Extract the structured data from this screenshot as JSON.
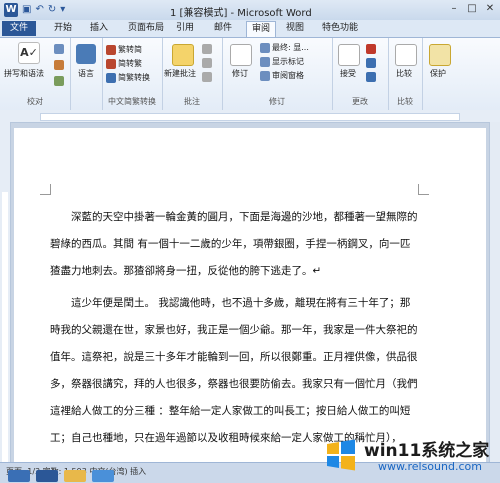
{
  "window": {
    "title": "1 [兼容模式] - Microsoft Word"
  },
  "tabs": [
    "文件",
    "开始",
    "插入",
    "页面布局",
    "引用",
    "邮件",
    "审阅",
    "视图",
    "特色功能"
  ],
  "active_tab": "审阅",
  "ribbon": {
    "proofing": {
      "big": "拼写和语法",
      "label": "校对"
    },
    "language": {
      "big": "语言"
    },
    "chinese": {
      "items": [
        "繁转简",
        "简转繁",
        "简繁转换"
      ],
      "label": "中文简繁转换"
    },
    "comments": {
      "big": "新建批注",
      "label": "批注"
    },
    "tracking": {
      "big": "修订",
      "final": "最终: 显...",
      "show_markup": "显示标记",
      "review_pane": "审阅窗格",
      "label": "修订"
    },
    "changes": {
      "big": "接受",
      "label": "更改"
    },
    "compare": {
      "big": "比较",
      "label": "比较"
    },
    "protect": {
      "big": "保护"
    }
  },
  "document": {
    "paragraphs": [
      [
        "深藍的天空中掛著一輪金黃的圓月，下面是海邊的沙地，都種著一望無際的",
        "碧綠的西瓜。其間 有一個十一二歲的少年，項帶銀圈，手捏一柄鋼叉，向一匹",
        "猹盡力地刺去。那猹卻將身一扭，反從他的胯下逃走了。↵"
      ],
      [
        "這少年便是閏土。 我認識他時，也不過十多歲，離現在將有三十年了；那",
        "時我的父親還在世，家景也好，我正是一個少爺。那一年，我家是一件大祭祀的",
        "值年。這祭祀，說是三十多年才能輪到一回，所以很鄭重。正月裡供像，供品很",
        "多，祭器很講究，拜的人也很多，祭器也很要防偷去。我家只有一個忙月（我們",
        "這裡給人做工的分三種 ：整年給一定人家做工的叫長工；按日給人做工的叫短",
        "工；自己也種地，只在過年過節以及收租時候來給一定人家做工的稱忙月），"
      ]
    ]
  },
  "status": {
    "text": "页面: 1/3 字数: 1,593 中文(台湾) 插入"
  },
  "watermark": {
    "brand": "win11系统之家",
    "site": "www.relsound.com"
  },
  "colors": {
    "accent": "#2b579a",
    "watermark_link": "#1a66c2"
  }
}
